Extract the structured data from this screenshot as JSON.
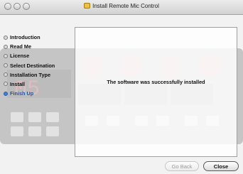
{
  "window": {
    "title": "Install Remote Mic Control"
  },
  "sidebar": {
    "steps": [
      {
        "label": "Introduction",
        "current": false
      },
      {
        "label": "Read Me",
        "current": false
      },
      {
        "label": "License",
        "current": false
      },
      {
        "label": "Select Destination",
        "current": false
      },
      {
        "label": "Installation Type",
        "current": false
      },
      {
        "label": "Install",
        "current": false
      },
      {
        "label": "Finish Up",
        "current": true
      }
    ]
  },
  "content": {
    "message": "The software was successfully installed"
  },
  "buttons": {
    "go_back": "Go Back",
    "close": "Close"
  },
  "colors": {
    "accent": "#3f7fd4",
    "window_bg": "#f2f2f2"
  }
}
